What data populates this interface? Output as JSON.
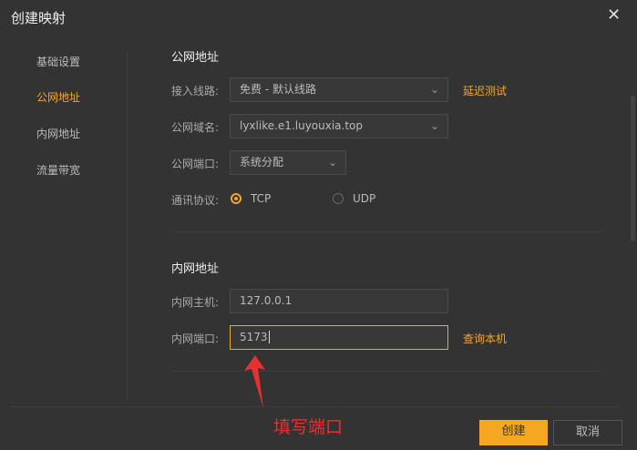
{
  "dialog": {
    "title": "创建映射",
    "close_icon": "close-icon"
  },
  "nav": [
    "基础设置",
    "公网地址",
    "内网地址",
    "流量带宽"
  ],
  "public": {
    "title": "公网地址",
    "line_label": "接入线路:",
    "line_value": "免费 - 默认线路",
    "latency_test": "延迟测试",
    "domain_label": "公网域名:",
    "domain_value": "lyxlike.e1.luyouxia.top",
    "port_label": "公网端口:",
    "port_value": "系统分配",
    "protocol_label": "通讯协议:",
    "tcp": "TCP",
    "udp": "UDP"
  },
  "private": {
    "title": "内网地址",
    "host_label": "内网主机:",
    "host_value": "127.0.0.1",
    "port_label": "内网端口:",
    "port_value": "5173",
    "query_local": "查询本机"
  },
  "footer": {
    "create": "创建",
    "cancel": "取消"
  },
  "annotation": {
    "text": "填写端口",
    "color": "#e83030"
  },
  "colors": {
    "accent": "#f5a623",
    "background": "#333333"
  }
}
